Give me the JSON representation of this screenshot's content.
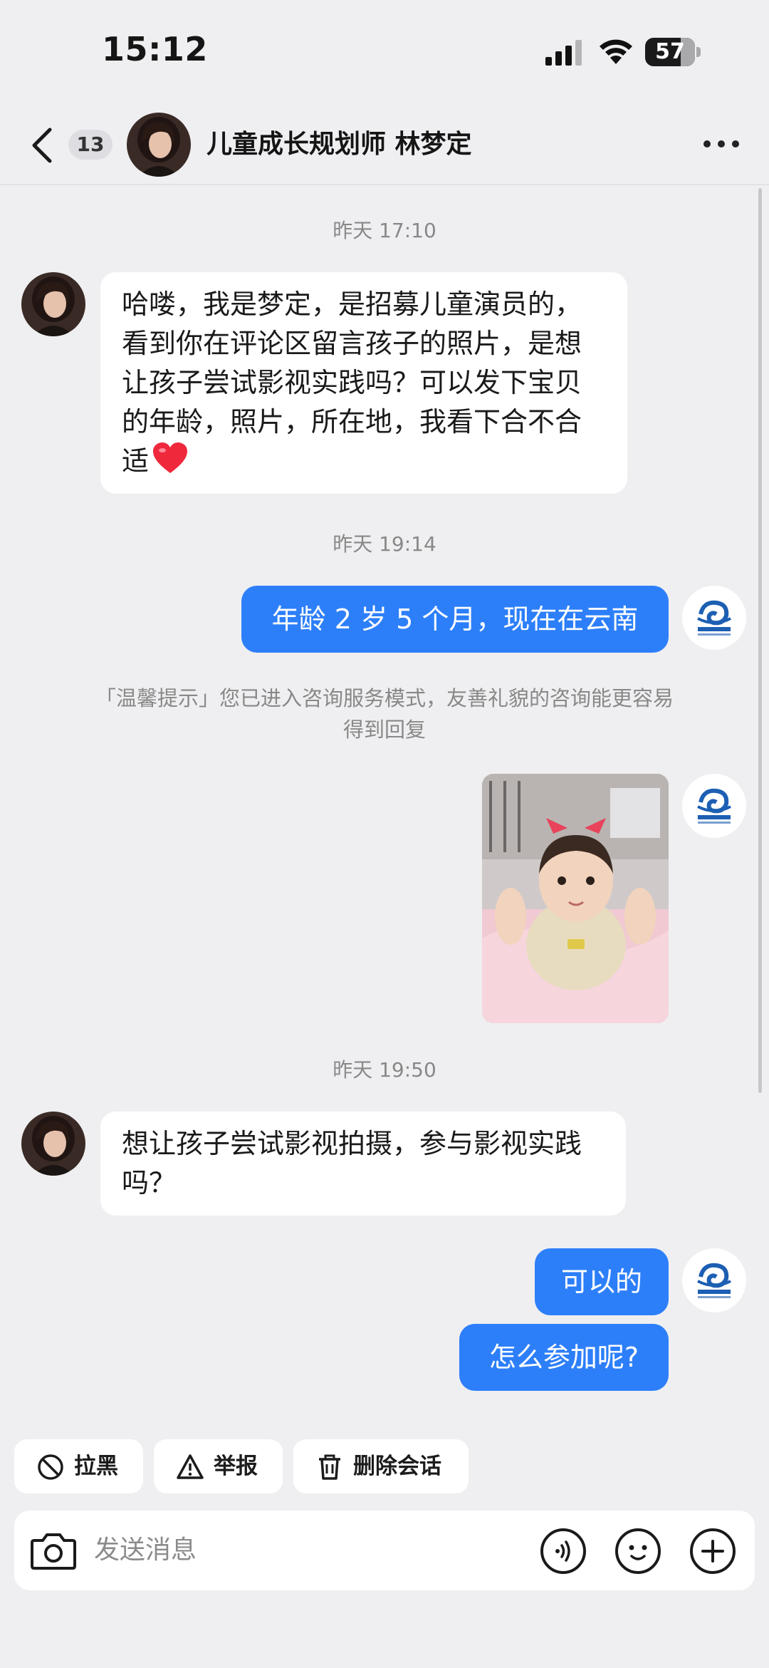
{
  "status_bar": {
    "time": "15:12",
    "battery": "57"
  },
  "header": {
    "unread_count": "13",
    "contact_name": "儿童成长规划师 林梦定"
  },
  "messages": [
    {
      "type": "timestamp",
      "text": "昨天 17:10"
    },
    {
      "type": "incoming",
      "text": "哈喽，我是梦定，是招募儿童演员的，看到你在评论区留言孩子的照片，是想让孩子尝试影视实践吗？可以发下宝贝的年龄，照片，所在地，我看下合不合适",
      "emoji": "heart"
    },
    {
      "type": "timestamp",
      "text": "昨天 19:14"
    },
    {
      "type": "outgoing",
      "text": "年龄 2 岁 5 个月，现在在云南"
    },
    {
      "type": "system_tip",
      "text": "「温馨提示」您已进入咨询服务模式，友善礼貌的咨询能更容易得到回复"
    },
    {
      "type": "outgoing_image",
      "description": "photo"
    },
    {
      "type": "timestamp",
      "text": "昨天 19:50"
    },
    {
      "type": "incoming",
      "text": "想让孩子尝试影视拍摄，参与影视实践吗？"
    },
    {
      "type": "outgoing",
      "text": "可以的"
    },
    {
      "type": "outgoing",
      "text": "怎么参加呢?"
    }
  ],
  "actions": {
    "block": "拉黑",
    "report": "举报",
    "delete": "删除会话"
  },
  "composer": {
    "placeholder": "发送消息"
  },
  "colors": {
    "accent": "#2d7ff9",
    "background": "#efeff1"
  }
}
